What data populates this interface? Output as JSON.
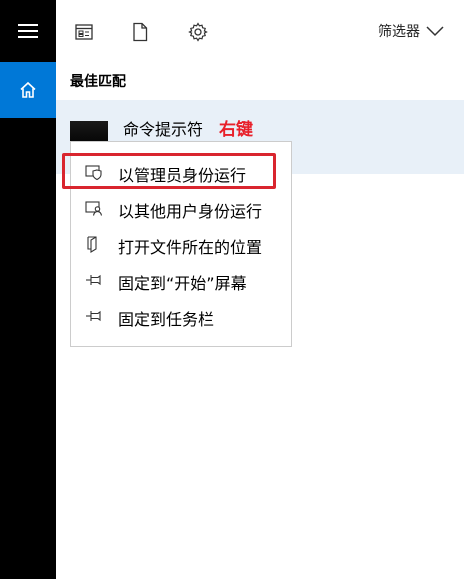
{
  "toolbar": {
    "filter_label": "筛选器"
  },
  "best_match": {
    "section_title": "最佳匹配",
    "app_name": "命令提示符",
    "annotation": "右键"
  },
  "context_menu": {
    "items": [
      {
        "label": "以管理员身份运行",
        "icon": "shield-icon"
      },
      {
        "label": "以其他用户身份运行",
        "icon": "user-switch-icon"
      },
      {
        "label": "打开文件所在的位置",
        "icon": "folder-open-icon"
      },
      {
        "label": "固定到“开始”屏幕",
        "icon": "pin-icon"
      },
      {
        "label": "固定到任务栏",
        "icon": "pin-icon"
      }
    ]
  },
  "colors": {
    "accent": "#0078d7",
    "annotation_red": "#e8202a",
    "selected_row": "#e8f0f8",
    "rail": "#000000"
  }
}
